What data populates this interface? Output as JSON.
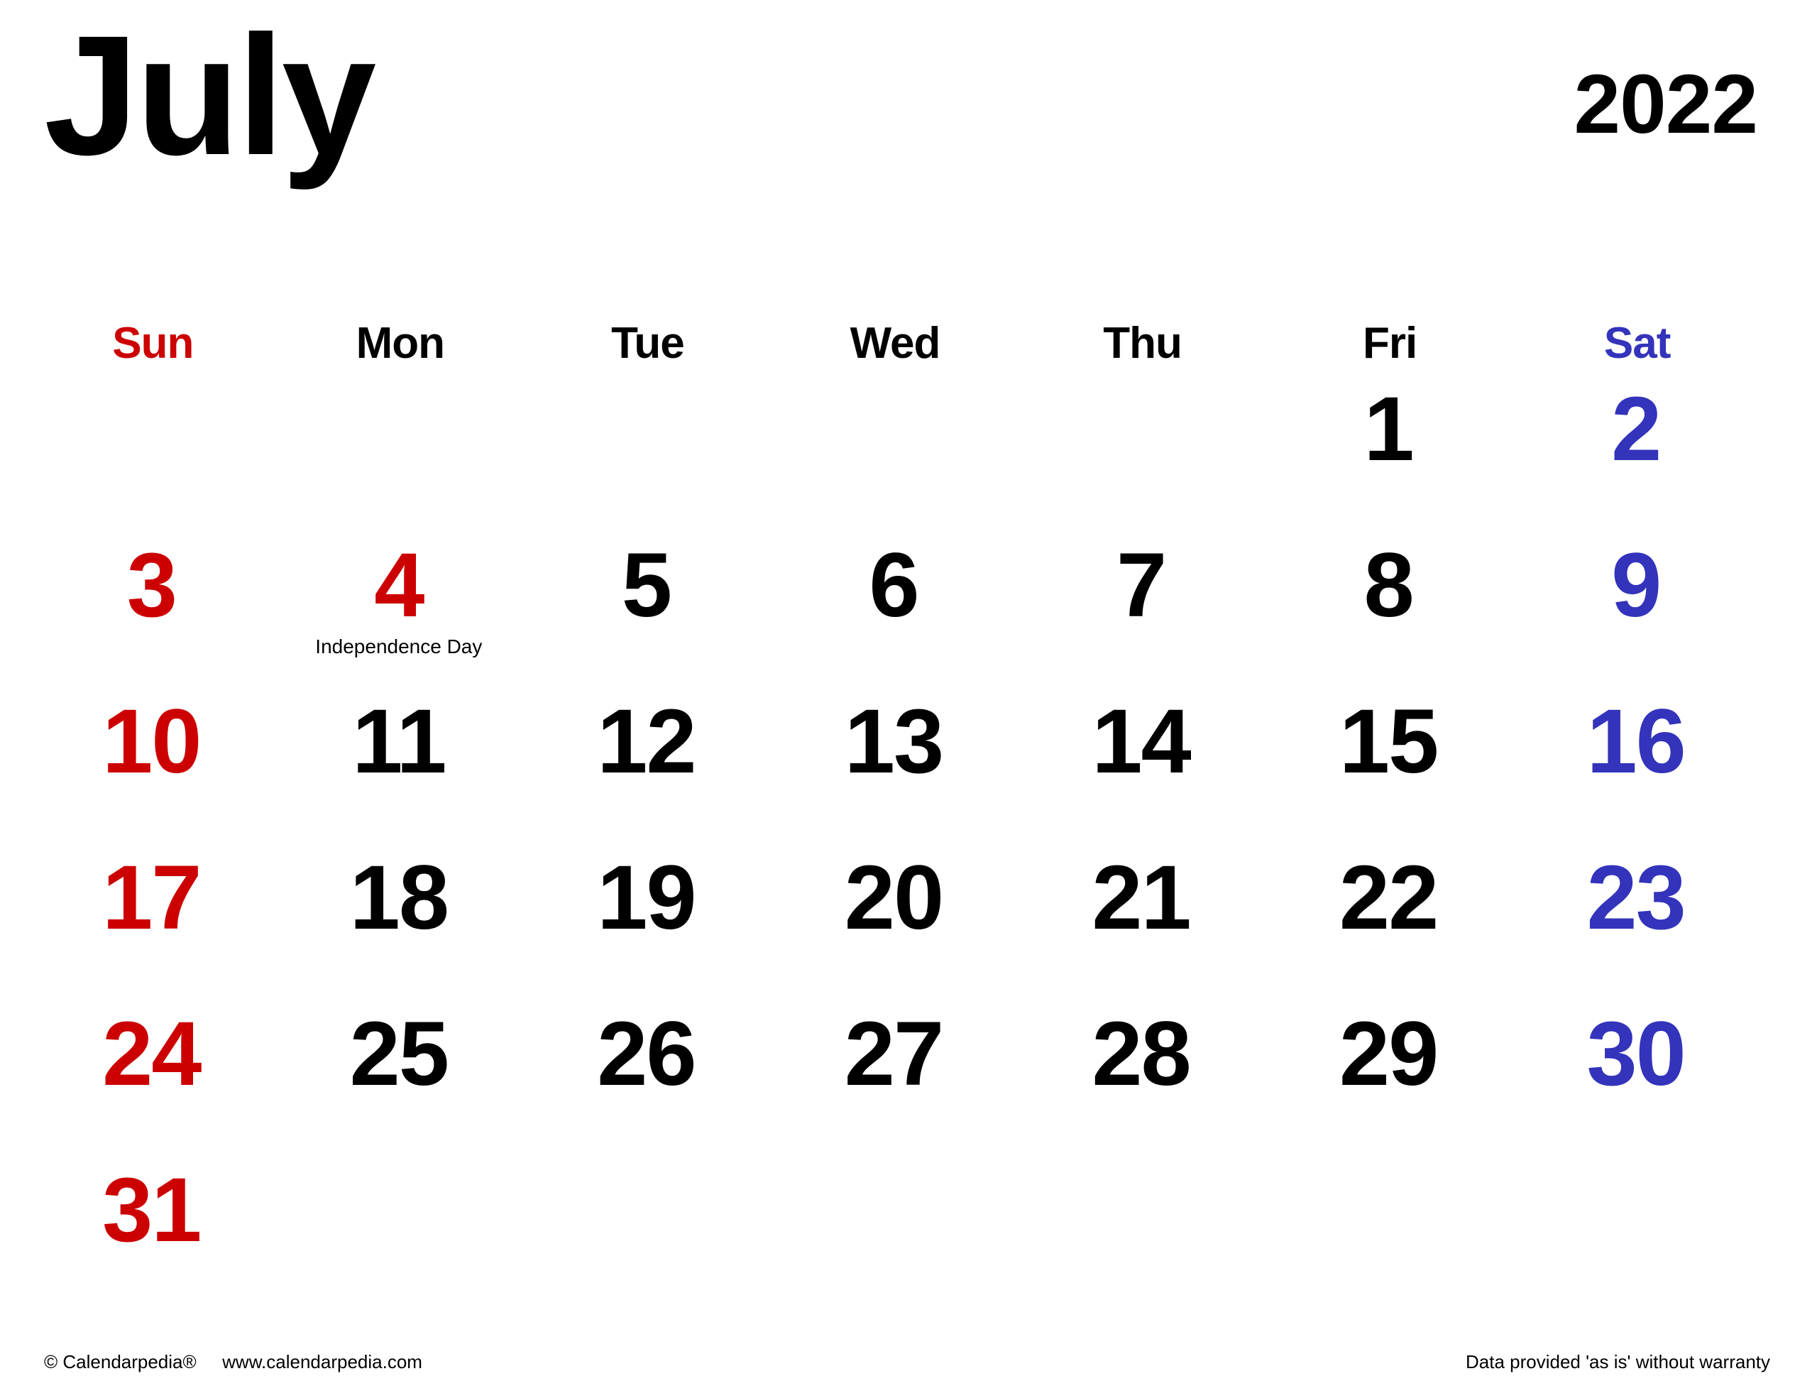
{
  "header": {
    "month": "July",
    "year": "2022"
  },
  "colors": {
    "weekday_default": "#000000",
    "sunday": "#cc0000",
    "saturday": "#3333bb",
    "holiday": "#cc0000",
    "background": "#ffffff"
  },
  "weekdays": [
    {
      "label": "Sun",
      "color_key": "sunday"
    },
    {
      "label": "Mon",
      "color_key": "weekday_default"
    },
    {
      "label": "Tue",
      "color_key": "weekday_default"
    },
    {
      "label": "Wed",
      "color_key": "weekday_default"
    },
    {
      "label": "Thu",
      "color_key": "weekday_default"
    },
    {
      "label": "Fri",
      "color_key": "weekday_default"
    },
    {
      "label": "Sat",
      "color_key": "saturday"
    }
  ],
  "weeks": [
    [
      {
        "day": "",
        "color": "black",
        "note": ""
      },
      {
        "day": "",
        "color": "black",
        "note": ""
      },
      {
        "day": "",
        "color": "black",
        "note": ""
      },
      {
        "day": "",
        "color": "black",
        "note": ""
      },
      {
        "day": "",
        "color": "black",
        "note": ""
      },
      {
        "day": "1",
        "color": "black",
        "note": ""
      },
      {
        "day": "2",
        "color": "blue",
        "note": ""
      }
    ],
    [
      {
        "day": "3",
        "color": "red",
        "note": ""
      },
      {
        "day": "4",
        "color": "red",
        "note": "Independence Day"
      },
      {
        "day": "5",
        "color": "black",
        "note": ""
      },
      {
        "day": "6",
        "color": "black",
        "note": ""
      },
      {
        "day": "7",
        "color": "black",
        "note": ""
      },
      {
        "day": "8",
        "color": "black",
        "note": ""
      },
      {
        "day": "9",
        "color": "blue",
        "note": ""
      }
    ],
    [
      {
        "day": "10",
        "color": "red",
        "note": ""
      },
      {
        "day": "11",
        "color": "black",
        "note": ""
      },
      {
        "day": "12",
        "color": "black",
        "note": ""
      },
      {
        "day": "13",
        "color": "black",
        "note": ""
      },
      {
        "day": "14",
        "color": "black",
        "note": ""
      },
      {
        "day": "15",
        "color": "black",
        "note": ""
      },
      {
        "day": "16",
        "color": "blue",
        "note": ""
      }
    ],
    [
      {
        "day": "17",
        "color": "red",
        "note": ""
      },
      {
        "day": "18",
        "color": "black",
        "note": ""
      },
      {
        "day": "19",
        "color": "black",
        "note": ""
      },
      {
        "day": "20",
        "color": "black",
        "note": ""
      },
      {
        "day": "21",
        "color": "black",
        "note": ""
      },
      {
        "day": "22",
        "color": "black",
        "note": ""
      },
      {
        "day": "23",
        "color": "blue",
        "note": ""
      }
    ],
    [
      {
        "day": "24",
        "color": "red",
        "note": ""
      },
      {
        "day": "25",
        "color": "black",
        "note": ""
      },
      {
        "day": "26",
        "color": "black",
        "note": ""
      },
      {
        "day": "27",
        "color": "black",
        "note": ""
      },
      {
        "day": "28",
        "color": "black",
        "note": ""
      },
      {
        "day": "29",
        "color": "black",
        "note": ""
      },
      {
        "day": "30",
        "color": "blue",
        "note": ""
      }
    ],
    [
      {
        "day": "31",
        "color": "red",
        "note": ""
      },
      {
        "day": "",
        "color": "black",
        "note": ""
      },
      {
        "day": "",
        "color": "black",
        "note": ""
      },
      {
        "day": "",
        "color": "black",
        "note": ""
      },
      {
        "day": "",
        "color": "black",
        "note": ""
      },
      {
        "day": "",
        "color": "black",
        "note": ""
      },
      {
        "day": "",
        "color": "black",
        "note": ""
      }
    ]
  ],
  "footer": {
    "copyright": "© Calendarpedia®",
    "website": "www.calendarpedia.com",
    "disclaimer": "Data provided 'as is' without warranty"
  }
}
